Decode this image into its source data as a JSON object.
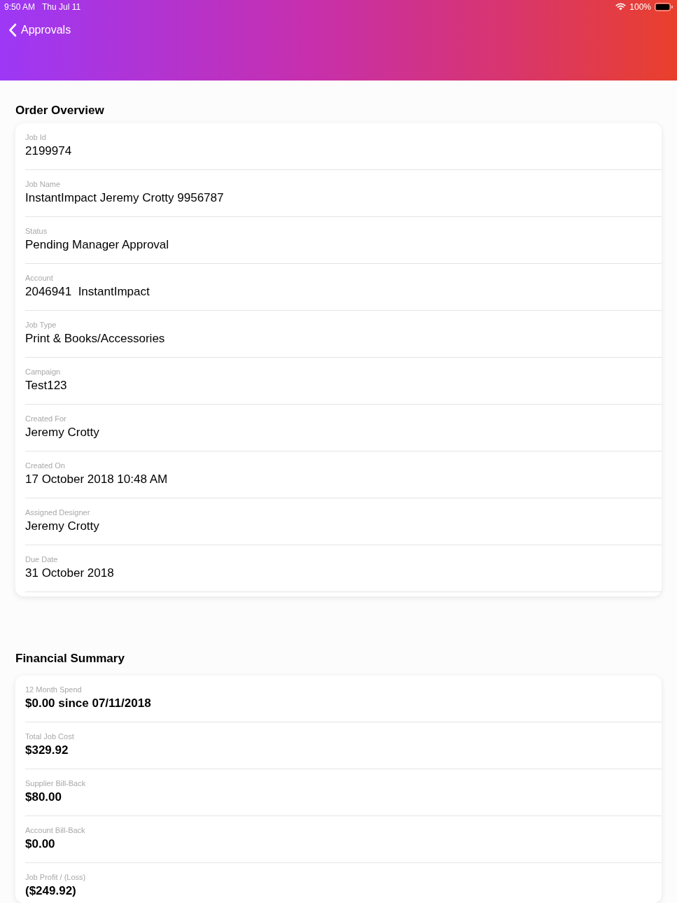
{
  "status_bar": {
    "time": "9:50 AM",
    "date": "Thu Jul 11",
    "battery": "100%"
  },
  "nav": {
    "back_label": "Approvals"
  },
  "sections": [
    {
      "title": "Order Overview",
      "emphasized": false,
      "fields": [
        {
          "label": "Job Id",
          "value": "2199974"
        },
        {
          "label": "Job Name",
          "value": "InstantImpact Jeremy Crotty 9956787"
        },
        {
          "label": "Status",
          "value": "Pending Manager Approval"
        },
        {
          "label": "Account",
          "value": "2046941  InstantImpact"
        },
        {
          "label": "Job Type",
          "value": "Print & Books/Accessories"
        },
        {
          "label": "Campaign",
          "value": "Test123"
        },
        {
          "label": "Created For",
          "value": "Jeremy Crotty"
        },
        {
          "label": "Created On",
          "value": "17 October 2018 10:48 AM"
        },
        {
          "label": "Assigned Designer",
          "value": "Jeremy Crotty"
        },
        {
          "label": "Due Date",
          "value": "31 October 2018"
        }
      ]
    },
    {
      "title": "Financial Summary",
      "emphasized": true,
      "fields": [
        {
          "label": "12 Month Spend",
          "value": "$0.00 since 07/11/2018"
        },
        {
          "label": "Total Job Cost",
          "value": "$329.92"
        },
        {
          "label": "Supplier Bill-Back",
          "value": "$80.00"
        },
        {
          "label": "Account Bill-Back",
          "value": "$0.00"
        },
        {
          "label": "Job Profit / (Loss)",
          "value": "($249.92)"
        }
      ]
    }
  ]
}
